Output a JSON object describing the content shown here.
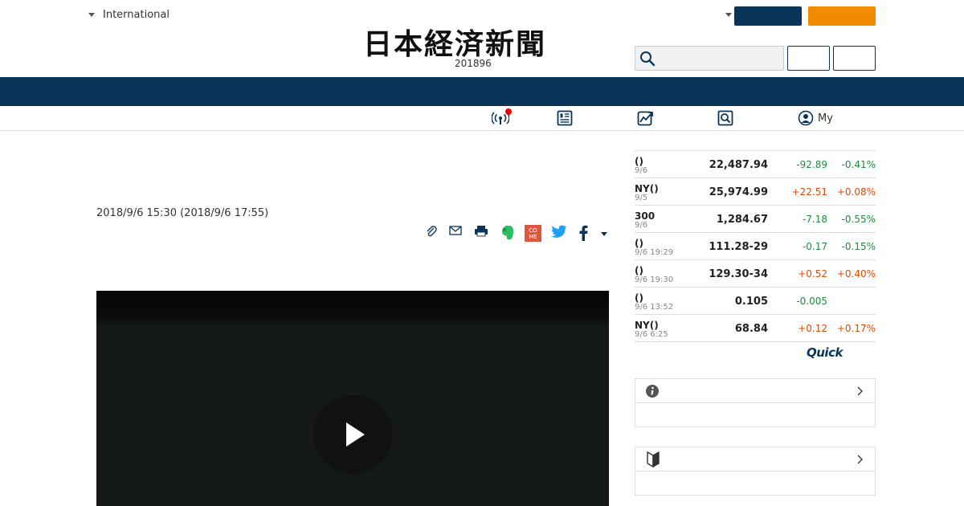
{
  "header": {
    "edition_label": "International",
    "logo_text": "日本経済新聞",
    "date_line": "201896"
  },
  "subnav": {
    "my_label": "My"
  },
  "article": {
    "date": "2018/9/6 15:30 (2018/9/6 17:55)"
  },
  "market": {
    "rows": [
      {
        "name": "()",
        "time": "9/6",
        "value": "22,487.94",
        "change": "-92.89",
        "pct": "-0.41%",
        "dir": "neg"
      },
      {
        "name": "NY()",
        "time": "9/5",
        "value": "25,974.99",
        "change": "+22.51",
        "pct": "+0.08%",
        "dir": "pos"
      },
      {
        "name": "300",
        "time": "9/6",
        "value": "1,284.67",
        "change": "-7.18",
        "pct": "-0.55%",
        "dir": "neg"
      },
      {
        "name": "()",
        "time": "9/6 19:29",
        "value": "111.28-29",
        "change": "-0.17",
        "pct": "-0.15%",
        "dir": "neg"
      },
      {
        "name": "()",
        "time": "9/6 19:30",
        "value": "129.30-34",
        "change": "+0.52",
        "pct": "+0.40%",
        "dir": "pos"
      },
      {
        "name": "()",
        "time": "9/6 13:52",
        "value": "0.105",
        "change": "-0.005",
        "pct": "",
        "dir": "neg"
      },
      {
        "name": "NY()",
        "time": "9/6 6:25",
        "value": "68.84",
        "change": "+0.12",
        "pct": "+0.17%",
        "dir": "pos"
      }
    ],
    "source_logo": "Quick"
  },
  "colors": {
    "navy": "#0b3459",
    "orange": "#f28b00",
    "negative": "#1e8a3e",
    "positive": "#d94a0c"
  },
  "icons": {
    "subnav": [
      "broadcast-icon",
      "newspaper-icon",
      "chart-icon",
      "search-icon",
      "user-icon"
    ],
    "share": [
      "clip-icon",
      "mail-icon",
      "print-icon",
      "evernote-icon",
      "come-icon",
      "twitter-icon",
      "facebook-icon",
      "more-caret-icon"
    ],
    "sidebox": [
      "info-icon",
      "beginner-mark-icon"
    ]
  }
}
